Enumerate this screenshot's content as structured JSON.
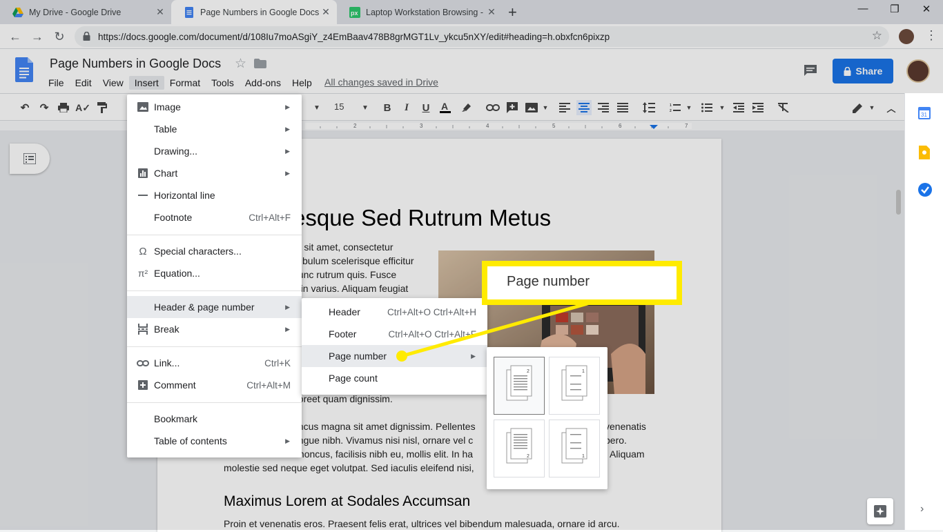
{
  "browser": {
    "tabs": [
      {
        "title": "My Drive - Google Drive",
        "icon": "google-drive-icon",
        "active": false
      },
      {
        "title": "Page Numbers in Google Docs - ",
        "icon": "google-docs-icon",
        "active": true
      },
      {
        "title": "Laptop Workstation Browsing - F",
        "icon": "pixabay-icon",
        "active": false
      }
    ],
    "new_tab": "+",
    "url": "https://docs.google.com/document/d/108Iu7moASgiY_z4EmBaav478B8grMGT1Lv_ykcu5nXY/edit#heading=h.obxfcn6pixzp"
  },
  "docs": {
    "title": "Page Numbers in Google Docs",
    "menus": [
      "File",
      "Edit",
      "View",
      "Insert",
      "Format",
      "Tools",
      "Add-ons",
      "Help"
    ],
    "saved_status": "All changes saved in Drive",
    "share_label": "Share",
    "font_size": "15"
  },
  "document": {
    "heading": "esque Sed Rutrum Metus",
    "intro_lines": [
      "or sit amet, consectetur",
      "stibulum scelerisque efficitur",
      "nunc rutrum quis. Fusce",
      "a in varius. Aliquam feugiat"
    ],
    "after_image_line": "aoreet quam dignissim.",
    "para2_lines": [
      "oncus magna sit amet dignissim. Pellentes",
      "ongue nibh. Vivamus nisi nisl, ornare vel c",
      "Donec id massa rhoncus, facilisis nibh eu, mollis elit. In ha",
      "molestie sed neque eget volutpat. Sed iaculis eleifend nisi,"
    ],
    "para2_right": [
      "venenatis",
      "bero.",
      ". Aliquam"
    ],
    "subheading": "Maximus Lorem at Sodales Accumsan",
    "last_line": "Proin et venenatis eros. Praesent felis erat, ultrices vel bibendum malesuada, ornare id arcu."
  },
  "insert_menu": {
    "items": [
      {
        "label": "Image",
        "icon": "image-icon",
        "shortcut": "",
        "submenu": true
      },
      {
        "label": "Table",
        "icon": "",
        "shortcut": "",
        "submenu": true
      },
      {
        "label": "Drawing...",
        "icon": "",
        "shortcut": "",
        "submenu": true
      },
      {
        "label": "Chart",
        "icon": "chart-icon",
        "shortcut": "",
        "submenu": true
      },
      {
        "label": "Horizontal line",
        "icon": "horizontal-line-icon",
        "shortcut": "",
        "submenu": false
      },
      {
        "label": "Footnote",
        "icon": "",
        "shortcut": "Ctrl+Alt+F",
        "submenu": false
      },
      {
        "label": "Special characters...",
        "icon": "omega-icon",
        "shortcut": "",
        "submenu": false
      },
      {
        "label": "Equation...",
        "icon": "pi-icon",
        "shortcut": "",
        "submenu": false
      },
      {
        "label": "Header & page number",
        "icon": "",
        "shortcut": "",
        "submenu": true
      },
      {
        "label": "Break",
        "icon": "break-icon",
        "shortcut": "",
        "submenu": true
      },
      {
        "label": "Link...",
        "icon": "link-icon",
        "shortcut": "Ctrl+K",
        "submenu": false
      },
      {
        "label": "Comment",
        "icon": "comment-icon",
        "shortcut": "Ctrl+Alt+M",
        "submenu": false
      },
      {
        "label": "Bookmark",
        "icon": "",
        "shortcut": "",
        "submenu": false
      },
      {
        "label": "Table of contents",
        "icon": "",
        "shortcut": "",
        "submenu": true
      }
    ]
  },
  "header_submenu": {
    "items": [
      {
        "label": "Header",
        "shortcut": "Ctrl+Alt+O Ctrl+Alt+H"
      },
      {
        "label": "Footer",
        "shortcut": "Ctrl+Alt+O Ctrl+Alt+F"
      },
      {
        "label": "Page number",
        "shortcut": ""
      },
      {
        "label": "Page count",
        "shortcut": ""
      }
    ]
  },
  "page_number_options": [
    {
      "number_position": "top-right",
      "first_page": true
    },
    {
      "number_position": "top-right",
      "first_page": false
    },
    {
      "number_position": "bottom-right",
      "first_page": true
    },
    {
      "number_position": "bottom-right",
      "first_page": false
    }
  ],
  "callout": {
    "label": "Page number",
    "color": "#ffeb00"
  },
  "colors": {
    "share_blue": "#1a73e8",
    "docs_blue": "#4285f4"
  }
}
